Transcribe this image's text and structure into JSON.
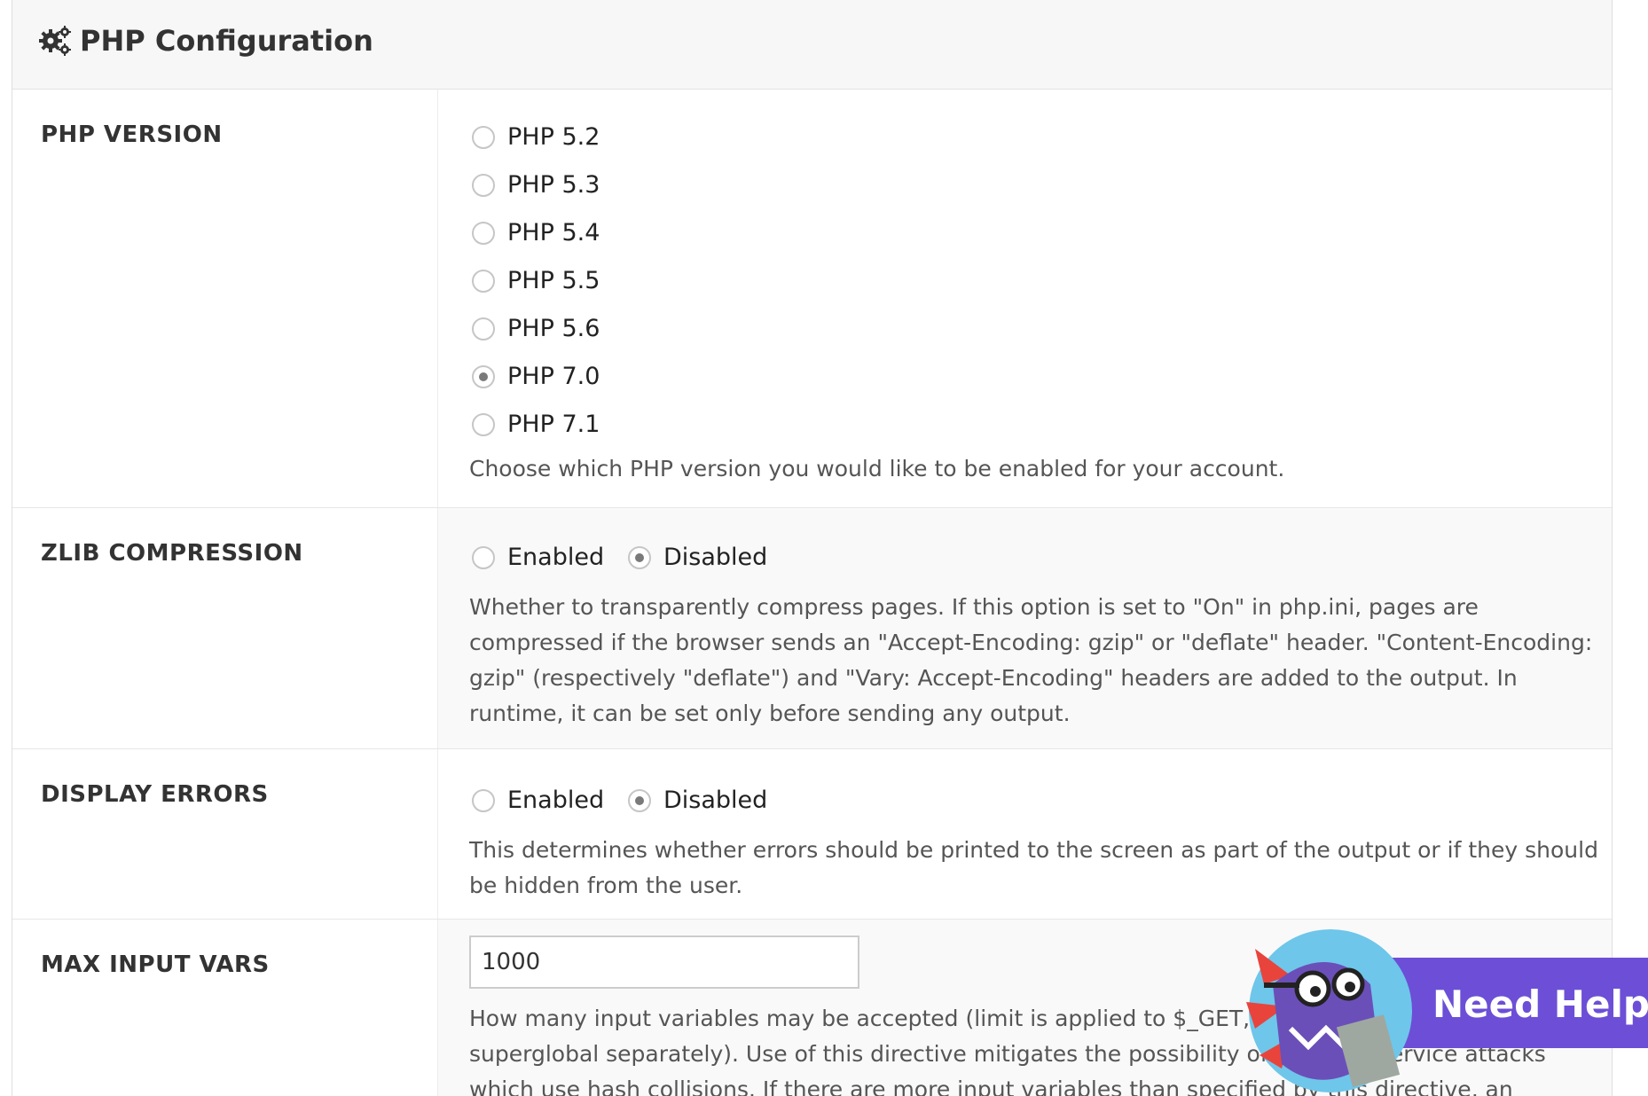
{
  "panel": {
    "title": "PHP Configuration",
    "icon": "gears-icon"
  },
  "php_version": {
    "label": "PHP VERSION",
    "options": [
      "PHP 5.2",
      "PHP 5.3",
      "PHP 5.4",
      "PHP 5.5",
      "PHP 5.6",
      "PHP 7.0",
      "PHP 7.1"
    ],
    "selected": "PHP 7.0",
    "description": "Choose which PHP version you would like to be enabled for your account."
  },
  "zlib": {
    "label": "ZLIB COMPRESSION",
    "enabled_label": "Enabled",
    "disabled_label": "Disabled",
    "selected": "Disabled",
    "description": "Whether to transparently compress pages. If this option is set to \"On\" in php.ini, pages are compressed if the browser sends an \"Accept-Encoding: gzip\" or \"deflate\" header. \"Content-Encoding: gzip\" (respectively \"deflate\") and \"Vary: Accept-Encoding\" headers are added to the output. In runtime, it can be set only before sending any output."
  },
  "display_errors": {
    "label": "DISPLAY ERRORS",
    "enabled_label": "Enabled",
    "disabled_label": "Disabled",
    "selected": "Disabled",
    "description": "This determines whether errors should be printed to the screen as part of the output or if they should be hidden from the user."
  },
  "max_input_vars": {
    "label": "MAX INPUT VARS",
    "value": "1000",
    "description": "How many input variables may be accepted (limit is applied to $_GET, $_POST and $_COOKIE superglobal separately). Use of this directive mitigates the possibility of denial of service attacks which use hash collisions. If there are more input variables than specified by this directive, an E_WARNING is issued, and"
  },
  "help_widget": {
    "label": "Need Help?"
  },
  "colors": {
    "highlight": "#e8332c",
    "help_bar": "#6c4fd6"
  }
}
